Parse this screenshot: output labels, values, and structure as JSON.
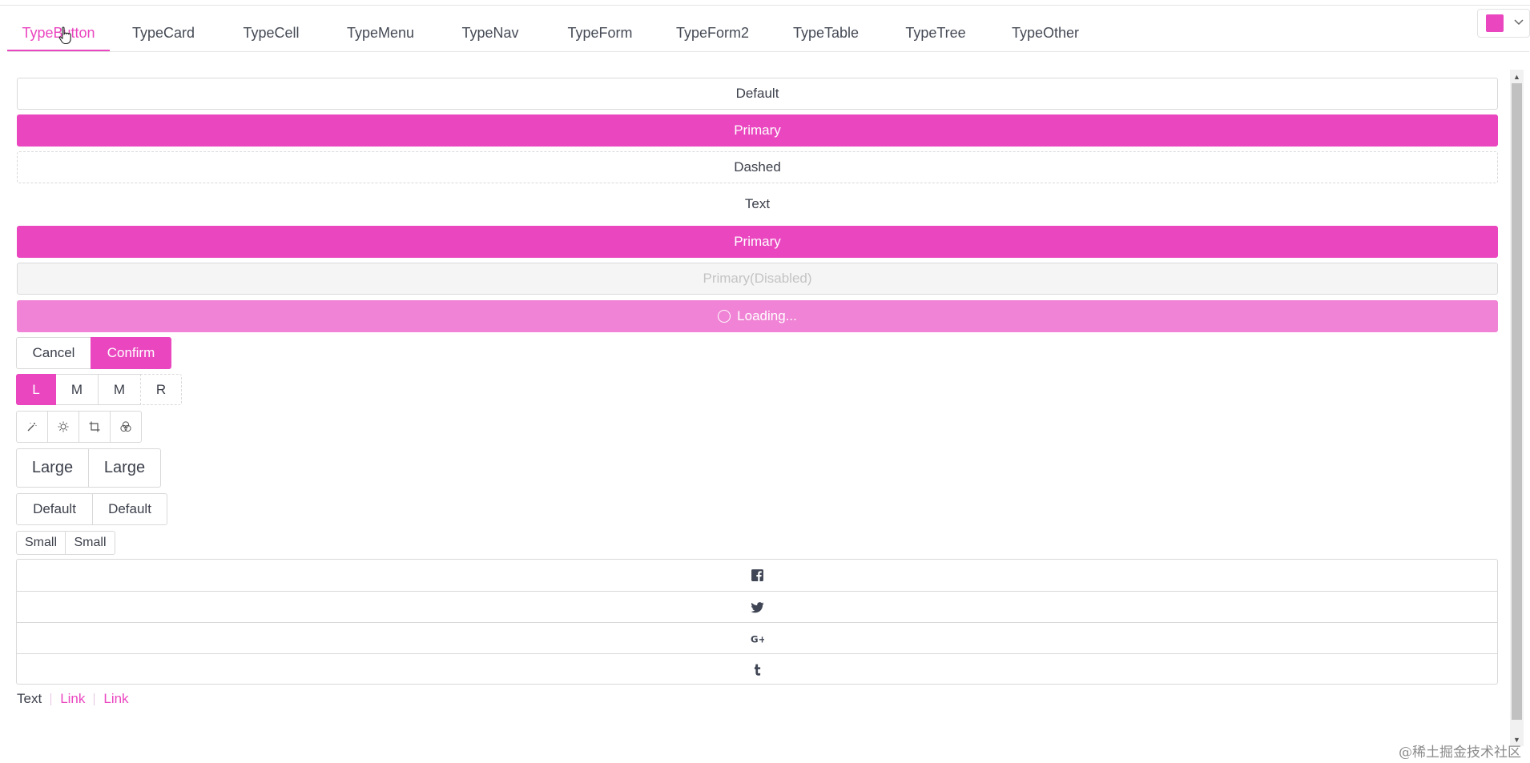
{
  "tabs": [
    {
      "label": "TypeButton",
      "active": true
    },
    {
      "label": "TypeCard"
    },
    {
      "label": "TypeCell"
    },
    {
      "label": "TypeMenu"
    },
    {
      "label": "TypeNav"
    },
    {
      "label": "TypeForm"
    },
    {
      "label": "TypeForm2"
    },
    {
      "label": "TypeTable"
    },
    {
      "label": "TypeTree"
    },
    {
      "label": "TypeOther"
    }
  ],
  "theme": {
    "color": "#ea46c0",
    "icon": "chevron-down-icon"
  },
  "buttons": {
    "default": "Default",
    "primary": "Primary",
    "dashed": "Dashed",
    "text": "Text",
    "primary2": "Primary",
    "disabled": "Primary(Disabled)",
    "loading": "Loading..."
  },
  "confirm_group": {
    "cancel": "Cancel",
    "confirm": "Confirm"
  },
  "position_group": [
    "L",
    "M",
    "M",
    "R"
  ],
  "icon_group": [
    "magic-wand-icon",
    "sun-icon",
    "crop-icon",
    "color-filter-icon"
  ],
  "size_groups": {
    "large": [
      "Large",
      "Large"
    ],
    "default": [
      "Default",
      "Default"
    ],
    "small": [
      "Small",
      "Small"
    ]
  },
  "social": [
    "facebook-icon",
    "twitter-icon",
    "google-plus-icon",
    "tumblr-icon"
  ],
  "links": {
    "text": "Text",
    "link1": "Link",
    "link2": "Link"
  },
  "watermark": "@稀土掘金技术社区",
  "colors": {
    "primary": "#ea46c0",
    "loading": "#f083d5",
    "border": "#d9d9d9",
    "text": "#3b3f4a"
  }
}
